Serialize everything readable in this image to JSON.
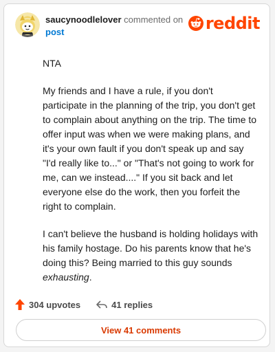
{
  "comment": {
    "username": "saucynoodlelover",
    "action_text": "commented on",
    "post_link": "post",
    "brand": "reddit",
    "paragraphs": {
      "p1": "NTA",
      "p2": "My friends and I have a rule, if you don't participate in the planning of the trip, you don't get to complain about anything on the trip. The time to offer input was when we were making plans, and it's your own fault if you don't speak up and say \"I'd really like to...\" or \"That's not going to work for me, can we instead....\" If you sit back and let everyone else do the work, then you forfeit the right to complain.",
      "p3_main": "I can't believe the husband is holding holidays with his family hostage. Do his parents know that he's doing this? Being married to this guy sounds ",
      "p3_emphasis": "exhausting",
      "p3_end": "."
    }
  },
  "actions": {
    "upvotes": "304 upvotes",
    "replies": "41 replies",
    "view_comments": "View 41 comments"
  },
  "colors": {
    "brand": "#ff4500",
    "link": "#0079d3",
    "view_button_text": "#d93900"
  },
  "icons": {
    "avatar": "snoo-avatar-icon",
    "brand": "reddit-logo-icon",
    "upvote": "upvote-arrow-icon",
    "reply": "reply-arrow-icon"
  }
}
